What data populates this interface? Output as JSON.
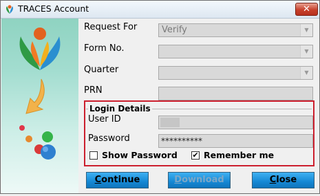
{
  "window": {
    "title": "TRACES Account",
    "close_glyph": "✕"
  },
  "form": {
    "request_for": {
      "label": "Request For",
      "value": "Verify"
    },
    "form_no": {
      "label": "Form No.",
      "value": ""
    },
    "quarter": {
      "label": "Quarter",
      "value": ""
    },
    "prn": {
      "label": "PRN",
      "value": ""
    }
  },
  "login": {
    "title": "Login Details",
    "user_id": {
      "label": "User ID",
      "value": ""
    },
    "password": {
      "label": "Password",
      "value": "**********"
    },
    "show_password": {
      "label": "Show Password",
      "checked": false
    },
    "remember_me": {
      "label": "Remember me",
      "checked": true
    }
  },
  "buttons": {
    "continue": {
      "first": "C",
      "rest": "ontinue"
    },
    "download": {
      "first": "D",
      "rest": "ownload"
    },
    "close": {
      "first": "C",
      "rest": "lose"
    }
  },
  "colors": {
    "login_border": "#cc1f2e",
    "button_blue": "#1588d4"
  },
  "icons": [
    "app-logo-icon",
    "dropdown-arrow-icon",
    "checkbox-icon"
  ]
}
